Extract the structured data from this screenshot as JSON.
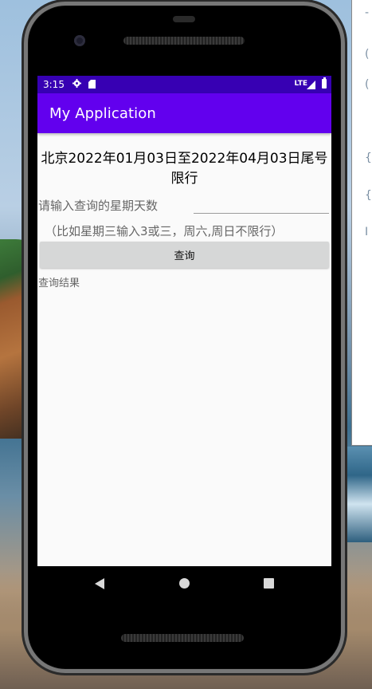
{
  "status_bar": {
    "time": "3:15",
    "network": "LTE",
    "icons": [
      "settings-icon",
      "sd-card-icon",
      "signal-icon",
      "battery-icon"
    ]
  },
  "app_bar": {
    "title": "My Application"
  },
  "main": {
    "headline": "北京2022年01月03日至2022年04月03日尾号限行",
    "prompt_label": "请输入查询的星期天数",
    "input_value": "",
    "hint": "（比如星期三输入3或三，周六,周日不限行）",
    "query_button_label": "查询",
    "result_text": "查询结果"
  },
  "nav_bar": {
    "icons": [
      "back-icon",
      "home-icon",
      "recents-icon"
    ]
  },
  "colors": {
    "status_bar": "#3700b3",
    "app_bar": "#6200ee",
    "button": "#d6d7d7",
    "screen_bg": "#fafafa"
  }
}
